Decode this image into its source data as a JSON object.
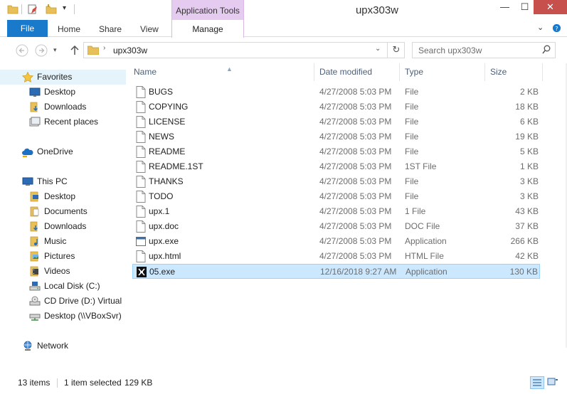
{
  "window": {
    "title": "upx303w",
    "contextual_tab_group": "Application Tools",
    "controls": {
      "minimize": "—",
      "maximize": "☐",
      "close": "✕"
    }
  },
  "ribbon": {
    "file_tab": "File",
    "tabs": [
      "Home",
      "Share",
      "View"
    ],
    "contextual_tab": "Manage",
    "collapse_icon": "chevron-down-icon",
    "help_icon": "help-icon"
  },
  "address_bar": {
    "path": "upx303w",
    "search_placeholder": "Search upx303w"
  },
  "nav_pane": {
    "favorites": {
      "label": "Favorites",
      "items": [
        "Desktop",
        "Downloads",
        "Recent places"
      ]
    },
    "onedrive": {
      "label": "OneDrive"
    },
    "this_pc": {
      "label": "This PC",
      "items": [
        "Desktop",
        "Documents",
        "Downloads",
        "Music",
        "Pictures",
        "Videos",
        "Local Disk (C:)",
        "CD Drive (D:) Virtual",
        "Desktop (\\\\VBoxSvr)"
      ]
    },
    "network": {
      "label": "Network"
    }
  },
  "file_list": {
    "columns": {
      "name": "Name",
      "date": "Date modified",
      "type": "Type",
      "size": "Size"
    },
    "rows": [
      {
        "name": "BUGS",
        "date": "4/27/2008 5:03 PM",
        "type": "File",
        "size": "2 KB",
        "icon": "document-icon"
      },
      {
        "name": "COPYING",
        "date": "4/27/2008 5:03 PM",
        "type": "File",
        "size": "18 KB",
        "icon": "document-icon"
      },
      {
        "name": "LICENSE",
        "date": "4/27/2008 5:03 PM",
        "type": "File",
        "size": "6 KB",
        "icon": "document-icon"
      },
      {
        "name": "NEWS",
        "date": "4/27/2008 5:03 PM",
        "type": "File",
        "size": "19 KB",
        "icon": "document-icon"
      },
      {
        "name": "README",
        "date": "4/27/2008 5:03 PM",
        "type": "File",
        "size": "5 KB",
        "icon": "document-icon"
      },
      {
        "name": "README.1ST",
        "date": "4/27/2008 5:03 PM",
        "type": "1ST File",
        "size": "1 KB",
        "icon": "document-icon"
      },
      {
        "name": "THANKS",
        "date": "4/27/2008 5:03 PM",
        "type": "File",
        "size": "3 KB",
        "icon": "document-icon"
      },
      {
        "name": "TODO",
        "date": "4/27/2008 5:03 PM",
        "type": "File",
        "size": "3 KB",
        "icon": "document-icon"
      },
      {
        "name": "upx.1",
        "date": "4/27/2008 5:03 PM",
        "type": "1 File",
        "size": "43 KB",
        "icon": "document-icon"
      },
      {
        "name": "upx.doc",
        "date": "4/27/2008 5:03 PM",
        "type": "DOC File",
        "size": "37 KB",
        "icon": "document-icon"
      },
      {
        "name": "upx.exe",
        "date": "4/27/2008 5:03 PM",
        "type": "Application",
        "size": "266 KB",
        "icon": "application-icon"
      },
      {
        "name": "upx.html",
        "date": "4/27/2008 5:03 PM",
        "type": "HTML File",
        "size": "42 KB",
        "icon": "document-icon"
      },
      {
        "name": "05.exe",
        "date": "12/16/2018 9:27 AM",
        "type": "Application",
        "size": "130 KB",
        "icon": "custom-exe-icon",
        "selected": true
      }
    ]
  },
  "status_bar": {
    "item_count": "13 items",
    "selection": "1 item selected",
    "selection_size": "129 KB"
  },
  "colors": {
    "file_tab": "#1979ca",
    "contextual_tab": "#e6cbf0",
    "selection": "#cce8ff",
    "close_button": "#c7504d"
  }
}
